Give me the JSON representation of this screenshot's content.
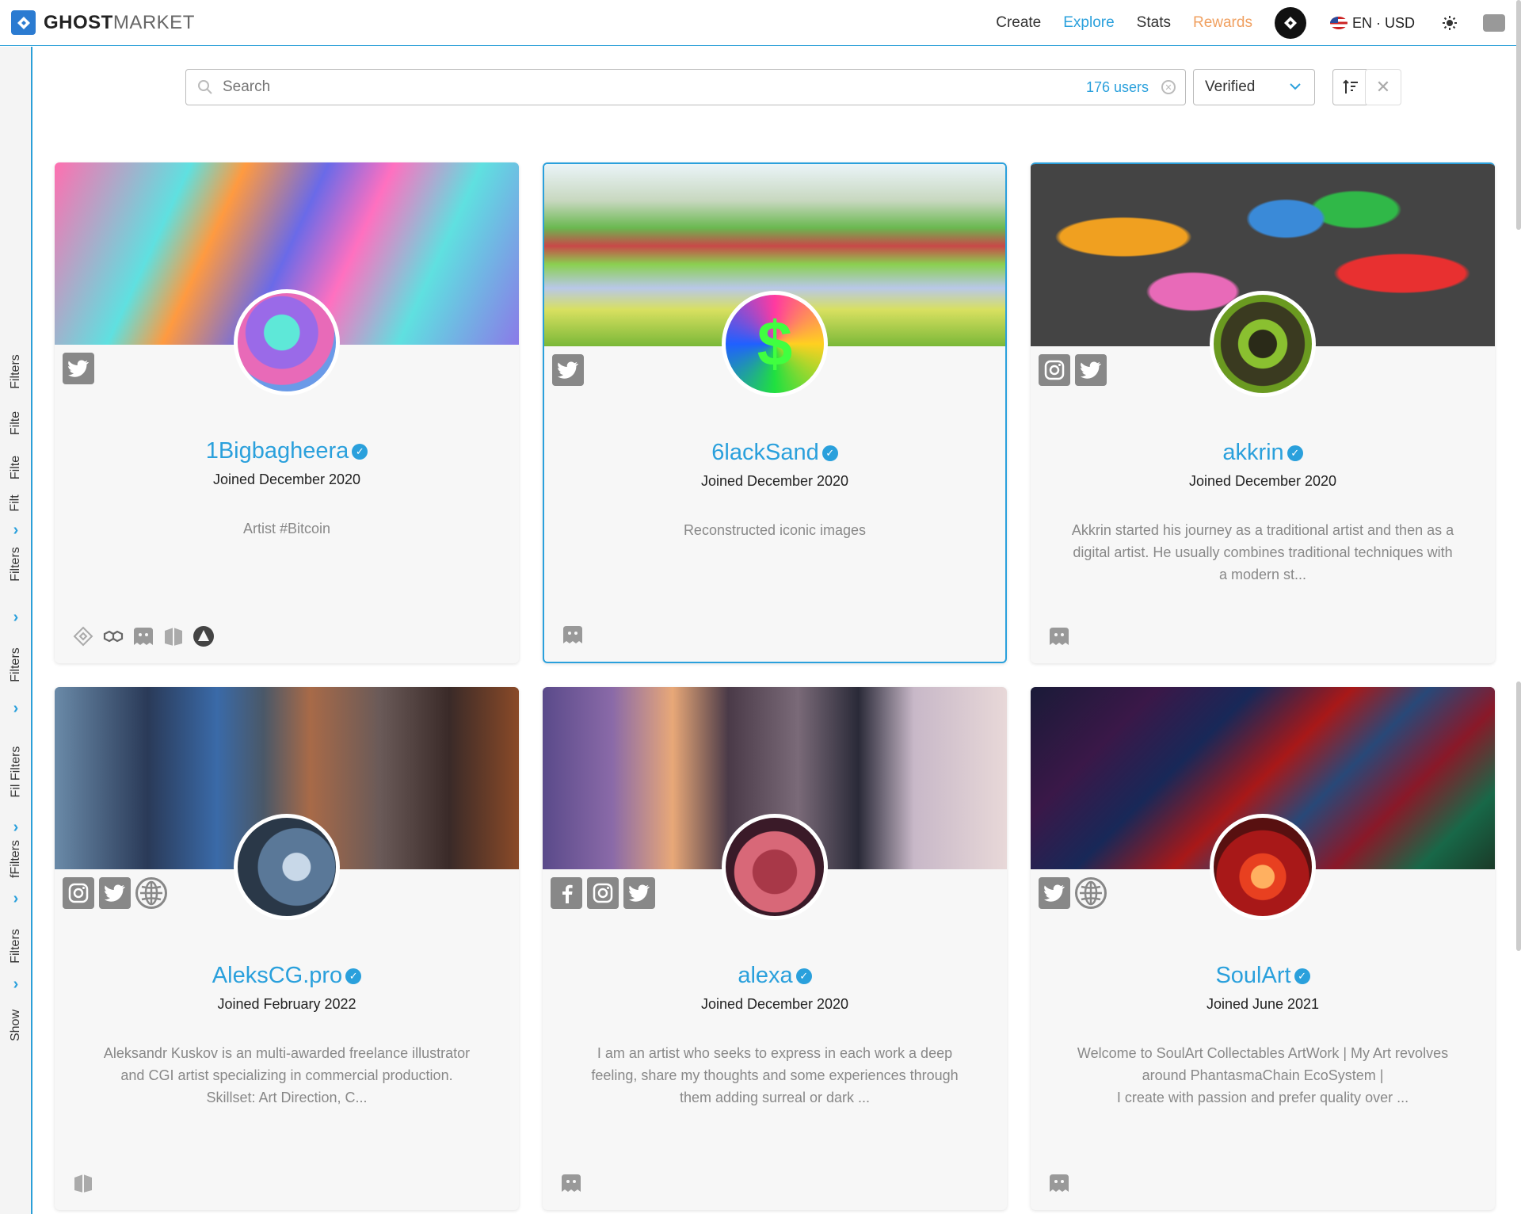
{
  "brand": {
    "bold": "GHOST",
    "light": "MARKET"
  },
  "nav": {
    "create": "Create",
    "explore": "Explore",
    "stats": "Stats",
    "rewards": "Rewards",
    "lang": "EN",
    "separator": "·",
    "currency": "USD"
  },
  "sidebar": {
    "labels": [
      "Filters",
      "Filte",
      "Filte",
      "Filt",
      "Filters",
      "Filters",
      "Fil Filters",
      "fFilters",
      "Filters",
      "Show"
    ]
  },
  "search": {
    "placeholder": "Search",
    "count": "176 users",
    "filter_value": "Verified"
  },
  "cards": [
    {
      "name": "1Bigbagheera",
      "joined": "Joined December 2020",
      "description": "Artist #Bitcoin",
      "socials": [
        "twitter-icon"
      ],
      "chains": [
        "bnb-icon",
        "polygon-icon",
        "ghost-icon",
        "ethereum-icon",
        "avalanche-icon"
      ]
    },
    {
      "name": "6lackSand",
      "joined": "Joined December 2020",
      "description": "Reconstructed iconic images",
      "socials": [
        "twitter-icon"
      ],
      "chains": [
        "ghost-icon"
      ]
    },
    {
      "name": "akkrin",
      "joined": "Joined December 2020",
      "description": "Akkrin started his journey as a traditional artist and then as a digital artist. He usually combines traditional techniques with a modern st...",
      "socials": [
        "instagram-icon",
        "twitter-icon"
      ],
      "chains": [
        "ghost-icon"
      ]
    },
    {
      "name": "AleksCG.pro",
      "joined": "Joined February 2022",
      "description": "Aleksandr Kuskov is an multi-awarded freelance illustrator and CGI artist specializing in commercial production.\nSkillset: Art Direction, C...",
      "socials": [
        "instagram-icon",
        "twitter-icon",
        "globe-icon"
      ],
      "chains": [
        "ethereum-icon"
      ]
    },
    {
      "name": "alexa",
      "joined": "Joined December 2020",
      "description": "I am an artist who seeks to express in each work a deep feeling, share my thoughts and some experiences through them adding surreal or dark ...",
      "socials": [
        "facebook-icon",
        "instagram-icon",
        "twitter-icon"
      ],
      "chains": [
        "ghost-icon"
      ]
    },
    {
      "name": "SoulArt",
      "joined": "Joined June 2021",
      "description": "Welcome to SoulArt Collectables ArtWork | My Art revolves around PhantasmaChain EcoSystem |\nI create with passion and prefer quality over ...",
      "socials": [
        "twitter-icon",
        "globe-icon"
      ],
      "chains": [
        "ghost-icon"
      ]
    }
  ],
  "colors": {
    "accent": "#2aa0dc",
    "rewards": "#f0a060",
    "logo": "#2b7bd1"
  }
}
